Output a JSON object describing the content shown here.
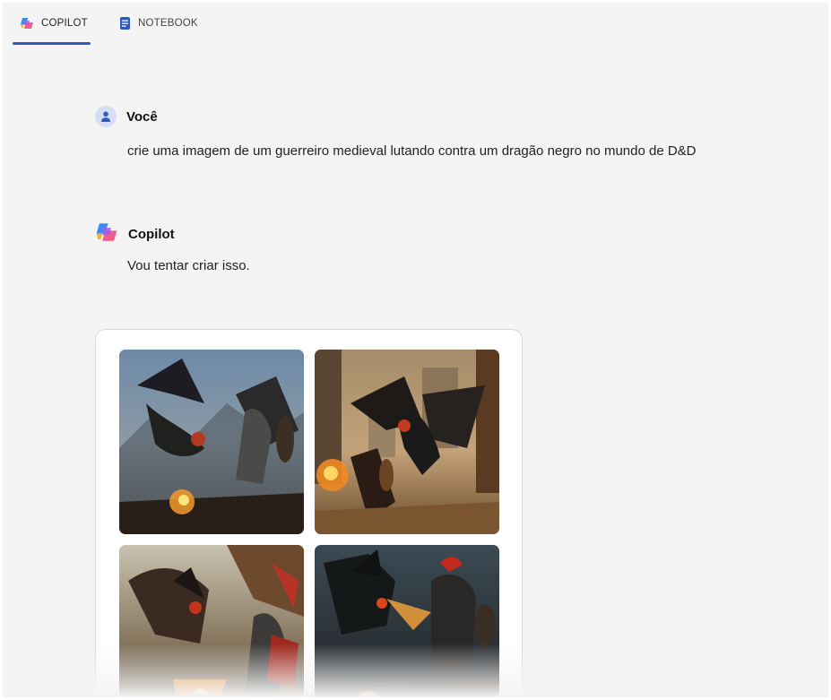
{
  "tabs": [
    {
      "label": "COPILOT",
      "active": true,
      "icon": "copilot-logo-icon"
    },
    {
      "label": "NOTEBOOK",
      "active": false,
      "icon": "notebook-icon"
    }
  ],
  "conversation": {
    "user": {
      "name": "Você",
      "icon": "user-avatar-icon",
      "text": "crie uma imagem de um guerreiro medieval lutando contra um dragão negro no mundo de D&D"
    },
    "assistant": {
      "name": "Copilot",
      "icon": "copilot-logo-icon",
      "text": "Vou tentar criar isso."
    }
  },
  "generated_images": {
    "count": 4,
    "descriptions": [
      "black dragon attacking armored warrior on mountain battlefield",
      "black dragon over burning castle courtyard with shield-bearing knight",
      "dragon breathing fire at knight with red cape and banner",
      "dark dragon facing knight with red plume in night battle"
    ]
  },
  "colors": {
    "accent": "#2f59c2",
    "background": "#f4f4f4",
    "avatar_bg": "#d7ddf5"
  }
}
